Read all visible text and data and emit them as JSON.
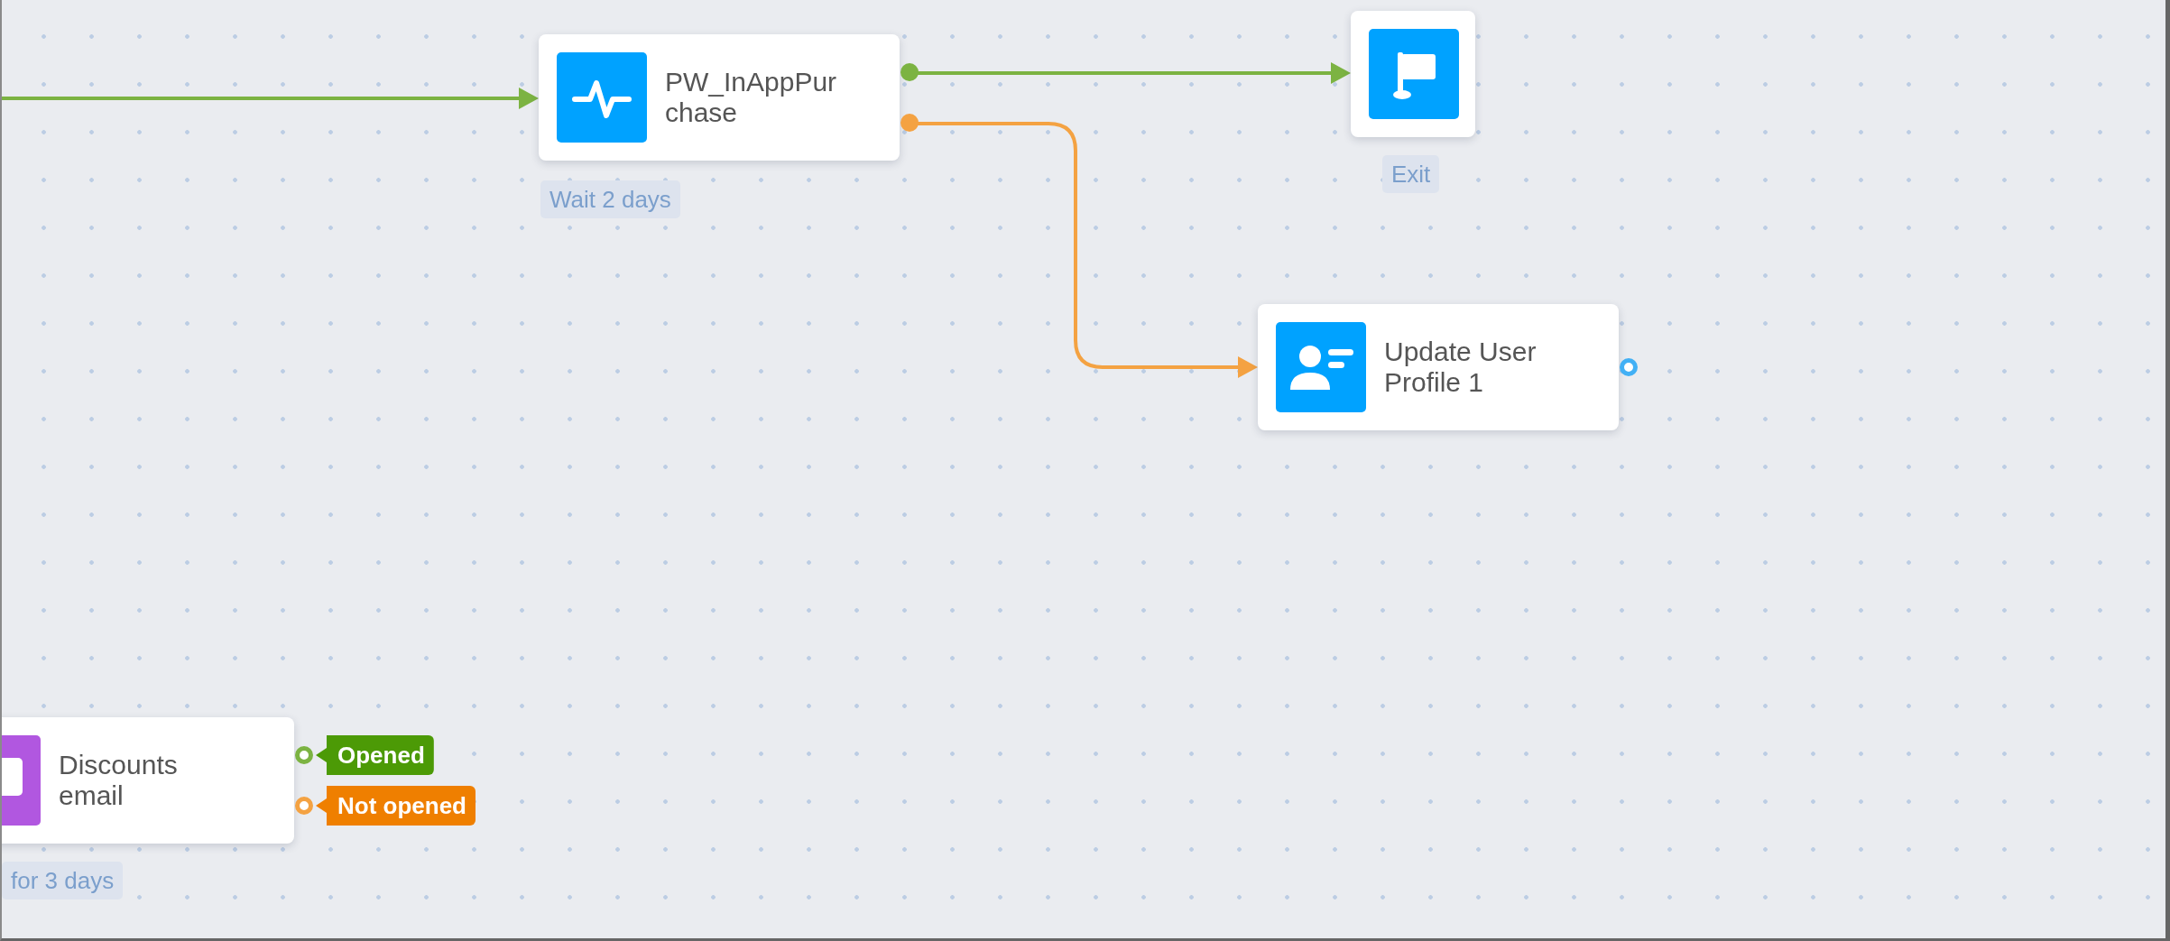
{
  "nodes": [
    {
      "kind": "event",
      "title": "PW_InAppPurchase",
      "color": "#00a2ff",
      "caption": "Wait 2 days",
      "ports": [
        {
          "color": "#7cb342",
          "connected": true
        },
        {
          "color": "#f4a242",
          "connected": true
        }
      ]
    },
    {
      "kind": "exit",
      "color": "#00a2ff",
      "caption": "Exit"
    },
    {
      "kind": "profile",
      "title": "Update User Profile 1",
      "color": "#00a2ff",
      "ports": [
        {
          "color": "#42b0f5",
          "connected": false
        }
      ]
    },
    {
      "kind": "email",
      "title": "Discounts email",
      "color": "#b157e0",
      "caption": "for 3 days",
      "ports": [
        {
          "color": "#7cb342",
          "connected": false,
          "tag": {
            "text": "Opened",
            "color": "#4c9a06"
          }
        },
        {
          "color": "#f4a242",
          "connected": false,
          "tag": {
            "text": "Not opened",
            "color": "#ef7f00"
          }
        }
      ]
    }
  ],
  "connectors": [
    {
      "color": "#7cb342"
    },
    {
      "color": "#7cb342"
    },
    {
      "color": "#f4a242"
    }
  ]
}
